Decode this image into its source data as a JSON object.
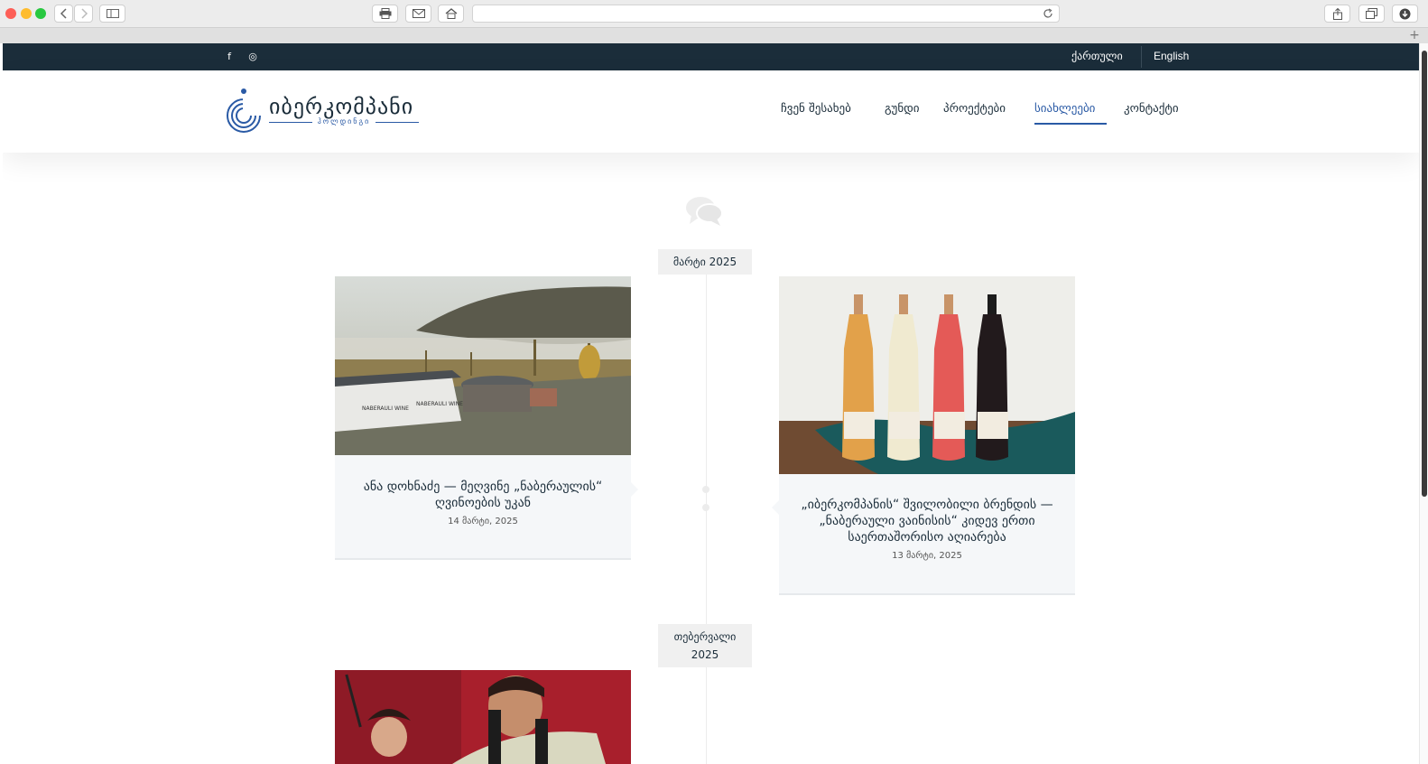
{
  "browser": {
    "icons": [
      "close-dot",
      "minimize-dot",
      "zoom-dot",
      "back-icon",
      "forward-icon",
      "sidebar-icon",
      "print-icon",
      "mail-icon",
      "home-icon",
      "reload-icon",
      "share-icon",
      "tabs-icon",
      "download-icon"
    ],
    "new_tab_label": "+"
  },
  "topbar": {
    "social": [
      "facebook-icon",
      "instagram-icon"
    ],
    "facebook_glyph": "f",
    "instagram_glyph": "◎",
    "languages": [
      {
        "label": "ქართული"
      },
      {
        "label": "English"
      }
    ]
  },
  "header": {
    "logo_text": "იბერკომპანი",
    "logo_subtext": "ჰოლდინგი",
    "nav": [
      {
        "label": "ჩვენ შესახებ",
        "active": false
      },
      {
        "label": "გუნდი",
        "active": false
      },
      {
        "label": "პროექტები",
        "active": false
      },
      {
        "label": "სიახლეები",
        "active": true
      },
      {
        "label": "კონტაქტი",
        "active": false
      }
    ]
  },
  "timeline": {
    "icon": "speech-bubbles-icon",
    "months": [
      {
        "label": "მარტი 2025"
      },
      {
        "label_line1": "თებერვალი",
        "label_line2": "2025"
      }
    ],
    "posts": [
      {
        "title": "ანა დოხნაძე — მეღვინე „ნაბერაულის“ ღვინოების უკან",
        "date": "14 მარტი, 2025",
        "image": "winery-in-fog-photo"
      },
      {
        "title": "„იბერკომპანის“ შვილობილი ბრენდის — „ნაბერაული ვაინისის“ კიდევ ერთი საერთაშორისო აღიარება",
        "date": "13 მარტი, 2025",
        "image": "wine-bottles-photo"
      },
      {
        "title": "",
        "date": "",
        "image": "people-with-wine-photo"
      }
    ]
  },
  "colors": {
    "topbar_bg": "#1b2d3a",
    "accent": "#2a5aa5",
    "card_bg": "#f5f7f9"
  }
}
